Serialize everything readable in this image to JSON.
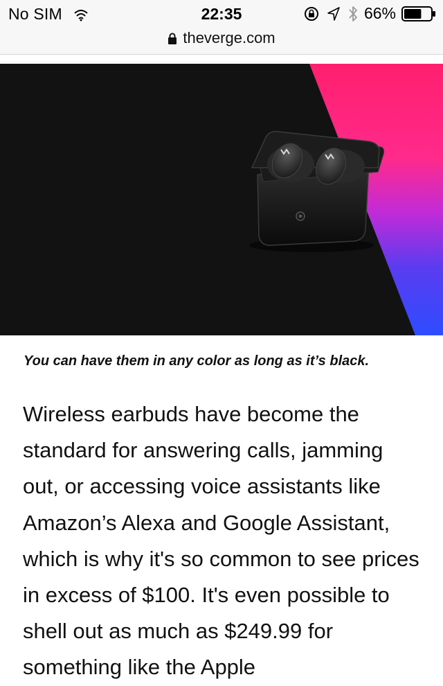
{
  "status_bar": {
    "carrier": "No SIM",
    "time": "22:35",
    "battery_percent": "66%",
    "battery_level": 0.66,
    "icons": [
      "wifi-icon",
      "orientation-lock-icon",
      "location-icon",
      "bluetooth-icon",
      "battery-icon"
    ]
  },
  "browser": {
    "url": "theverge.com",
    "icon": "lock-icon"
  },
  "article": {
    "image": {
      "description_icon": "earbuds-case-image",
      "colors": {
        "background": "#121212",
        "gradient": [
          "#ff1f6e",
          "#c02bd8",
          "#5a3cf0",
          "#2f4cff"
        ]
      }
    },
    "caption": "You can have them in any color as long as it’s black.",
    "body": "Wireless earbuds have become the standard for answering calls, jamming out, or accessing voice assistants like Amazon’s Alexa and Google Assistant, which is why it's so common to see prices in excess of $100. It's even possible to shell out as much as $249.99 for something like the Apple"
  }
}
